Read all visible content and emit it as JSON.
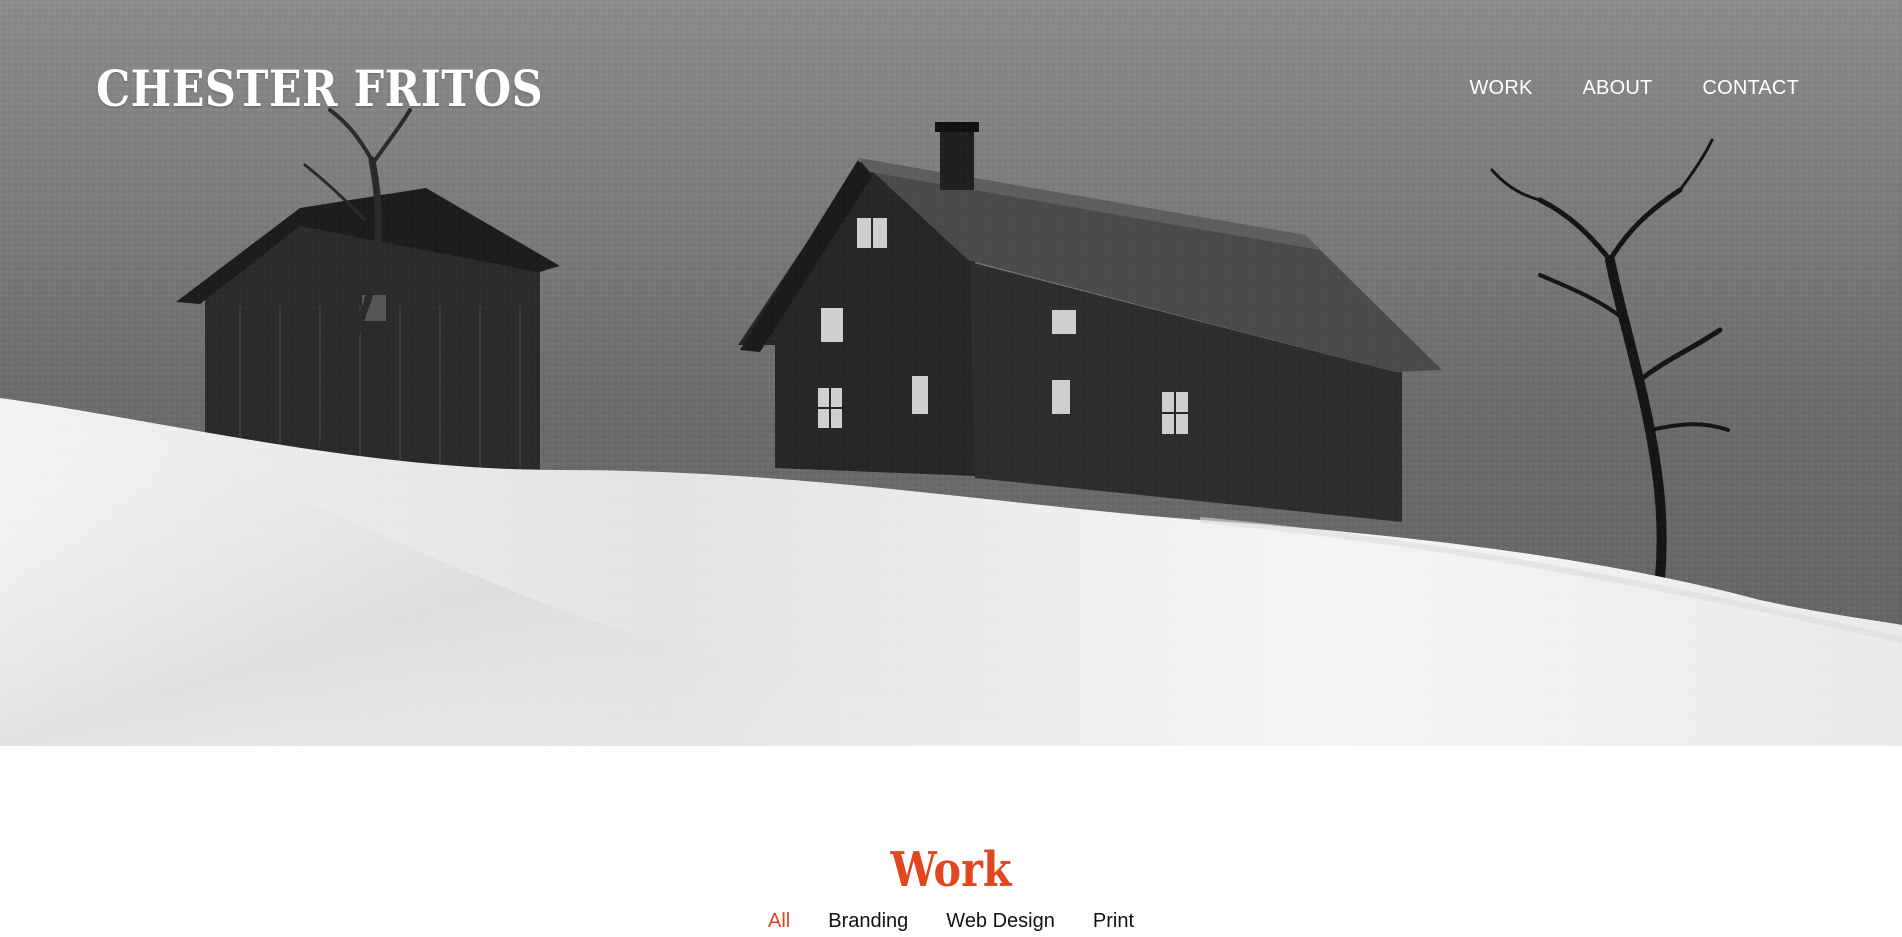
{
  "header": {
    "brand": "CHESTER FRITOS",
    "nav": [
      {
        "label": "WORK"
      },
      {
        "label": "ABOUT"
      },
      {
        "label": "CONTACT"
      }
    ]
  },
  "work": {
    "title": "Work",
    "filters": [
      {
        "label": "All",
        "active": true
      },
      {
        "label": "Branding",
        "active": false
      },
      {
        "label": "Web Design",
        "active": false
      },
      {
        "label": "Print",
        "active": false
      }
    ]
  },
  "colors": {
    "accent": "#e2461f",
    "text": "#111111"
  }
}
